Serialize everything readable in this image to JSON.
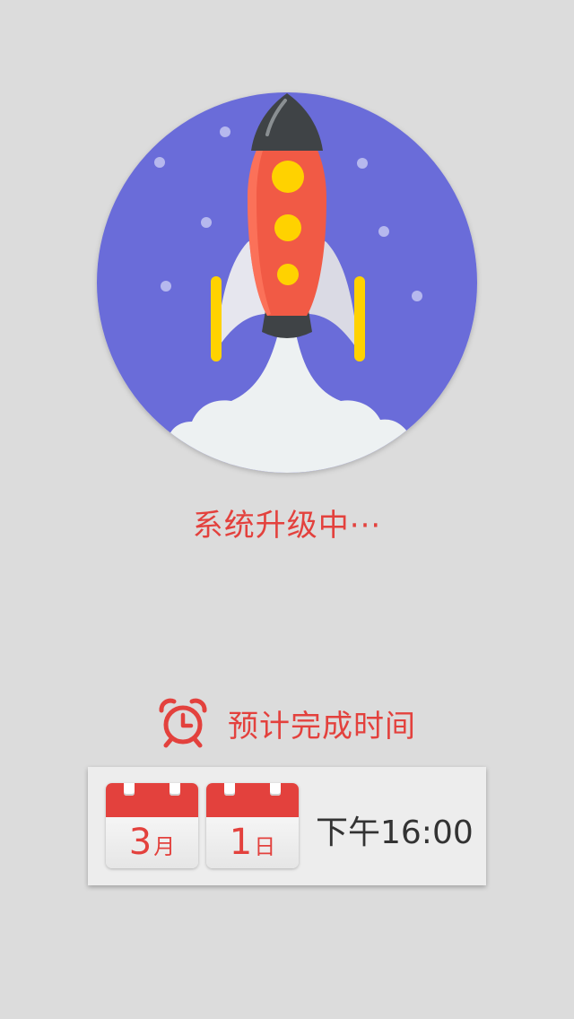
{
  "status": {
    "text": "系统升级中···"
  },
  "eta": {
    "label": "预计完成时间",
    "month_number": "3",
    "month_unit": "月",
    "day_number": "1",
    "day_unit": "日",
    "time": "下午16:00"
  },
  "icons": {
    "illustration": "rocket-launch-illustration",
    "eta": "alarm-clock-icon",
    "date": "calendar-icon"
  },
  "colors": {
    "background": "#dcdcdc",
    "accent": "#e3413d",
    "circle": "#6b6cd9",
    "rocket_body": "#f15a45",
    "portholes": "#ffd200",
    "card": "#ededed"
  }
}
